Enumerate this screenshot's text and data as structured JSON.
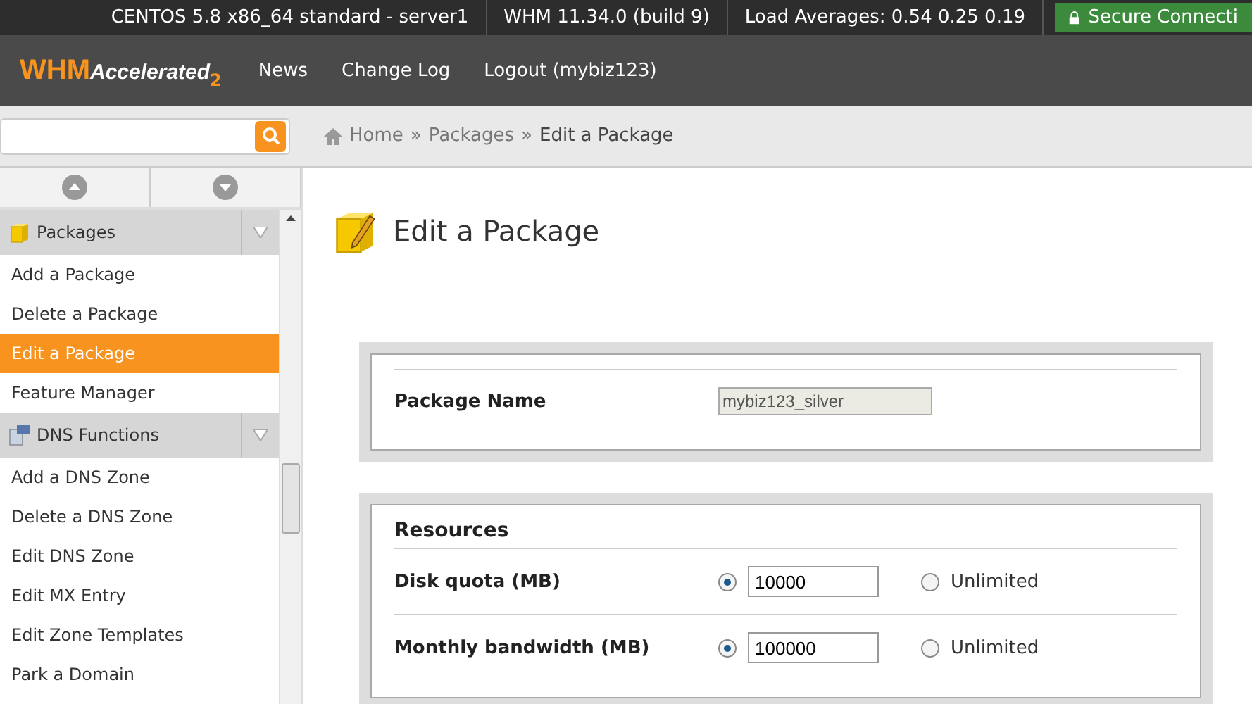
{
  "top_bar": {
    "items": [
      "CENTOS 5.8 x86_64 standard - server1",
      "WHM 11.34.0 (build 9)",
      "Load Averages: 0.54 0.25 0.19"
    ],
    "secure": "Secure Connecti"
  },
  "header": {
    "logo": {
      "brand": "WHM",
      "product": "Accelerated",
      "version": "2"
    },
    "nav": [
      "News",
      "Change Log",
      "Logout (mybiz123)"
    ]
  },
  "breadcrumb": {
    "items": [
      "Home",
      "Packages",
      "Edit a Package"
    ],
    "separators": [
      "»",
      "»"
    ]
  },
  "sidebar": {
    "groups": [
      {
        "title": "Packages",
        "items": [
          {
            "label": "Add a Package",
            "selected": false
          },
          {
            "label": "Delete a Package",
            "selected": false
          },
          {
            "label": "Edit a Package",
            "selected": true
          },
          {
            "label": "Feature Manager",
            "selected": false
          }
        ]
      },
      {
        "title": "DNS Functions",
        "items": [
          {
            "label": "Add a DNS Zone",
            "selected": false
          },
          {
            "label": "Delete a DNS Zone",
            "selected": false
          },
          {
            "label": "Edit DNS Zone",
            "selected": false
          },
          {
            "label": "Edit MX Entry",
            "selected": false
          },
          {
            "label": "Edit Zone Templates",
            "selected": false
          },
          {
            "label": "Park a Domain",
            "selected": false
          }
        ]
      }
    ]
  },
  "page_title": "Edit a Package",
  "package_name": {
    "label": "Package Name",
    "value": "mybiz123_silver"
  },
  "resources": {
    "title": "Resources",
    "rows": [
      {
        "label": "Disk quota (MB)",
        "options": [
          {
            "kind": "value",
            "selected": true,
            "value": "10000"
          },
          {
            "kind": "unlimited",
            "selected": false,
            "label": "Unlimited"
          }
        ]
      },
      {
        "label": "Monthly bandwidth (MB)",
        "options": [
          {
            "kind": "value",
            "selected": true,
            "value": "100000"
          },
          {
            "kind": "unlimited",
            "selected": false,
            "label": "Unlimited"
          }
        ]
      }
    ]
  }
}
